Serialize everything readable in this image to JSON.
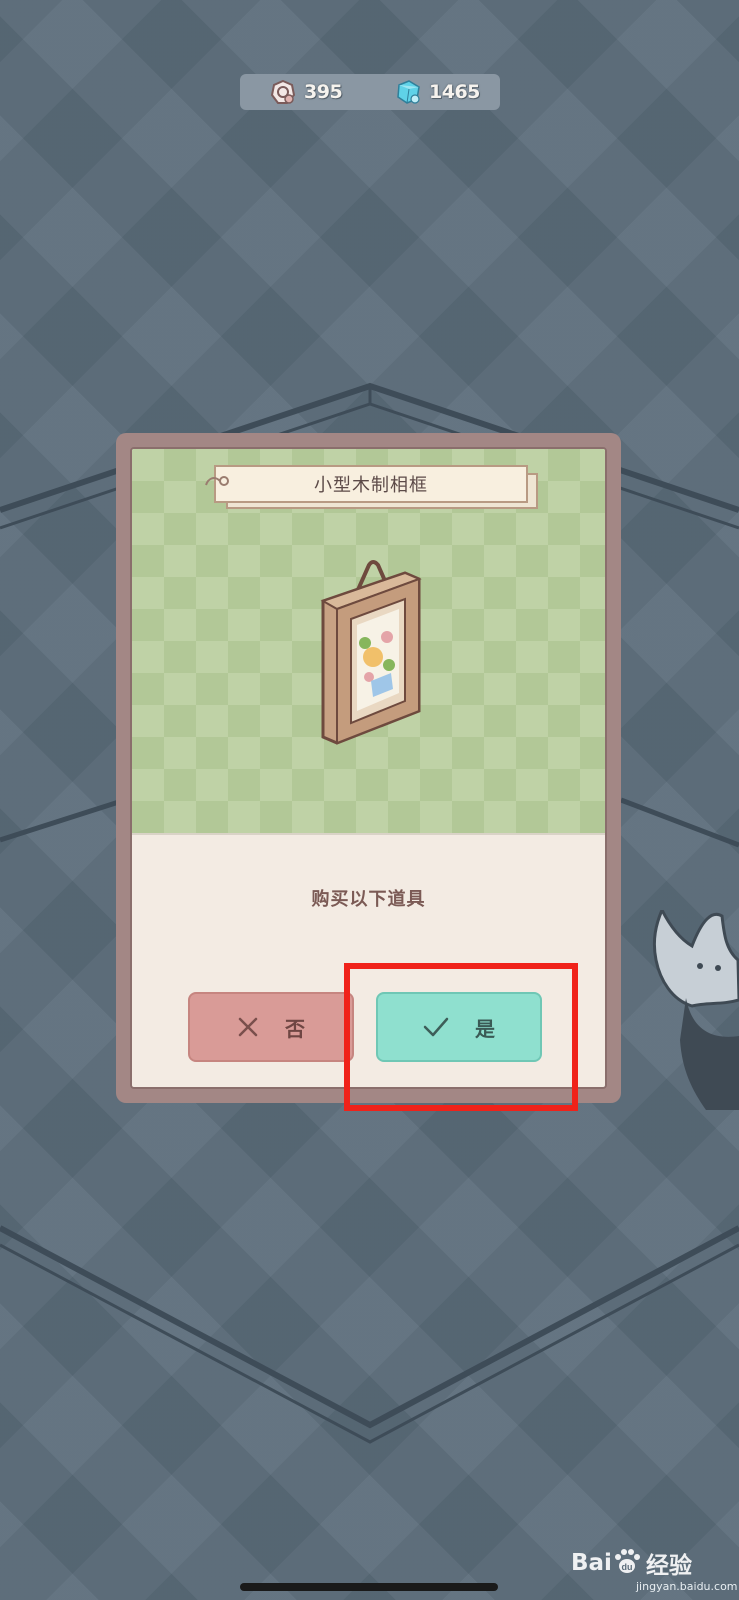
{
  "currency": {
    "coins": "395",
    "gems": "1465",
    "coin_icon": "coin-icon",
    "gem_icon": "gem-icon"
  },
  "dialog": {
    "item_title": "小型木制相框",
    "prompt": "购买以下道具",
    "no_button": {
      "label": "否",
      "icon": "close-icon"
    },
    "yes_button": {
      "label": "是",
      "icon": "check-icon"
    },
    "item_icon": "wooden-picture-frame"
  },
  "watermark": {
    "brand": "Bai",
    "paw": "du",
    "sub": "经验",
    "url": "jingyan.baidu.com"
  },
  "colors": {
    "highlight": "#f0221a",
    "yes_button": "#8fe0cf",
    "no_button": "#d99b97",
    "preview_bg": "#bfd2a6"
  }
}
